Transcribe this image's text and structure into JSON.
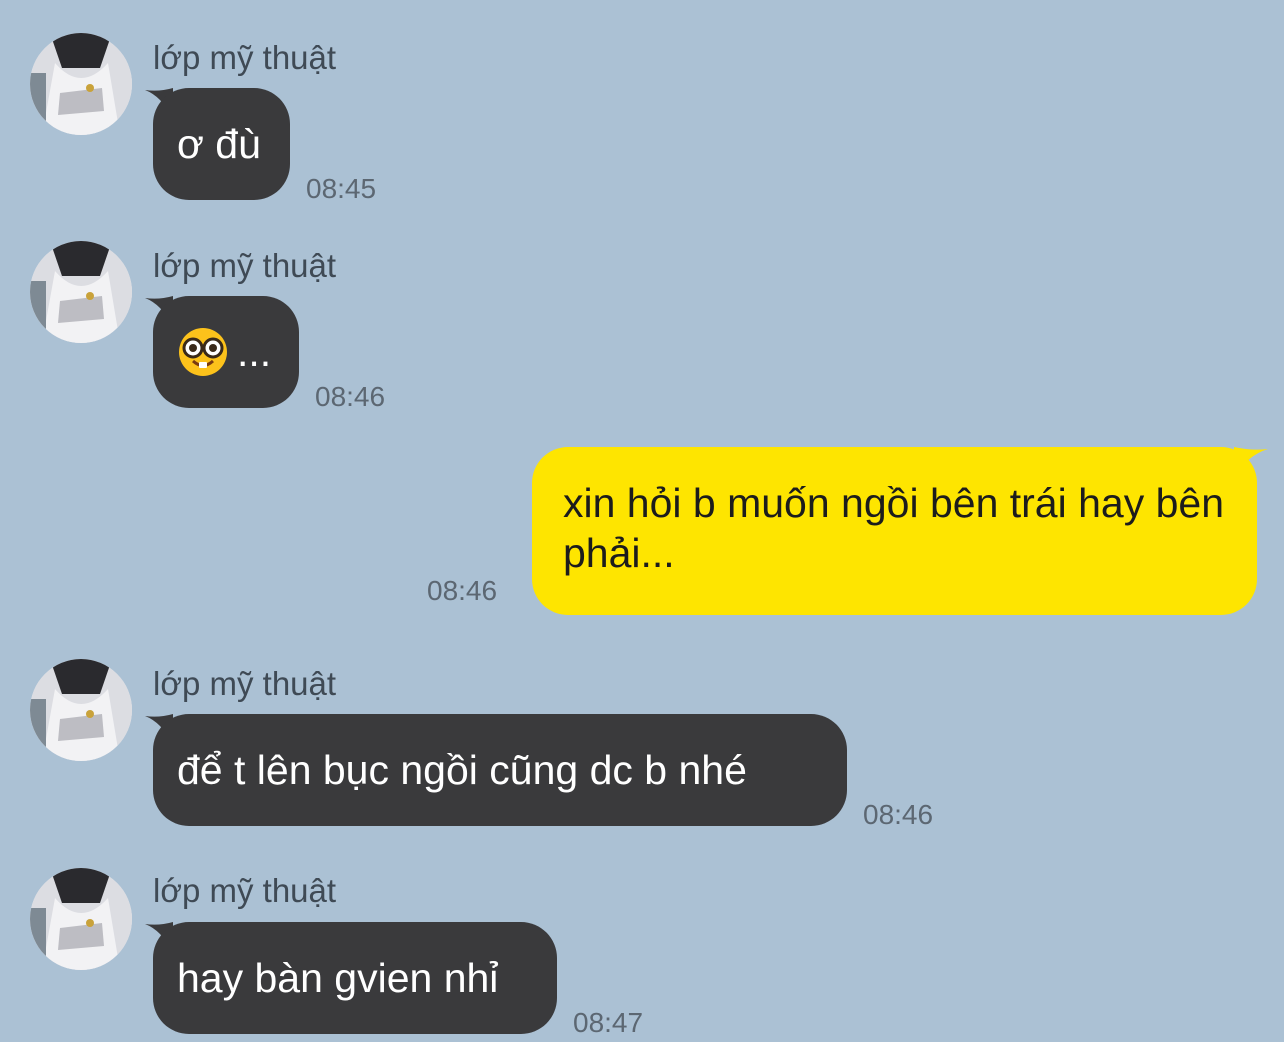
{
  "chat": {
    "messages": [
      {
        "sender": "lớp mỹ thuật",
        "text": "ơ đù",
        "time": "08:45",
        "direction": "incoming"
      },
      {
        "sender": "lớp mỹ thuật",
        "emoji": "nerd-face-emoji",
        "text": "...",
        "time": "08:46",
        "direction": "incoming"
      },
      {
        "text": "xin hỏi b muốn ngồi bên trái hay bên phải...",
        "time": "08:46",
        "direction": "outgoing"
      },
      {
        "sender": "lớp mỹ thuật",
        "text": "để t lên bục ngồi cũng dc b nhé",
        "time": "08:46",
        "direction": "incoming"
      },
      {
        "sender": "lớp mỹ thuật",
        "text": "hay bàn gvien nhỉ",
        "time": "08:47",
        "direction": "incoming"
      }
    ]
  },
  "colors": {
    "background": "#abc1d4",
    "incoming_bubble": "#3a3a3c",
    "outgoing_bubble": "#fee500"
  }
}
